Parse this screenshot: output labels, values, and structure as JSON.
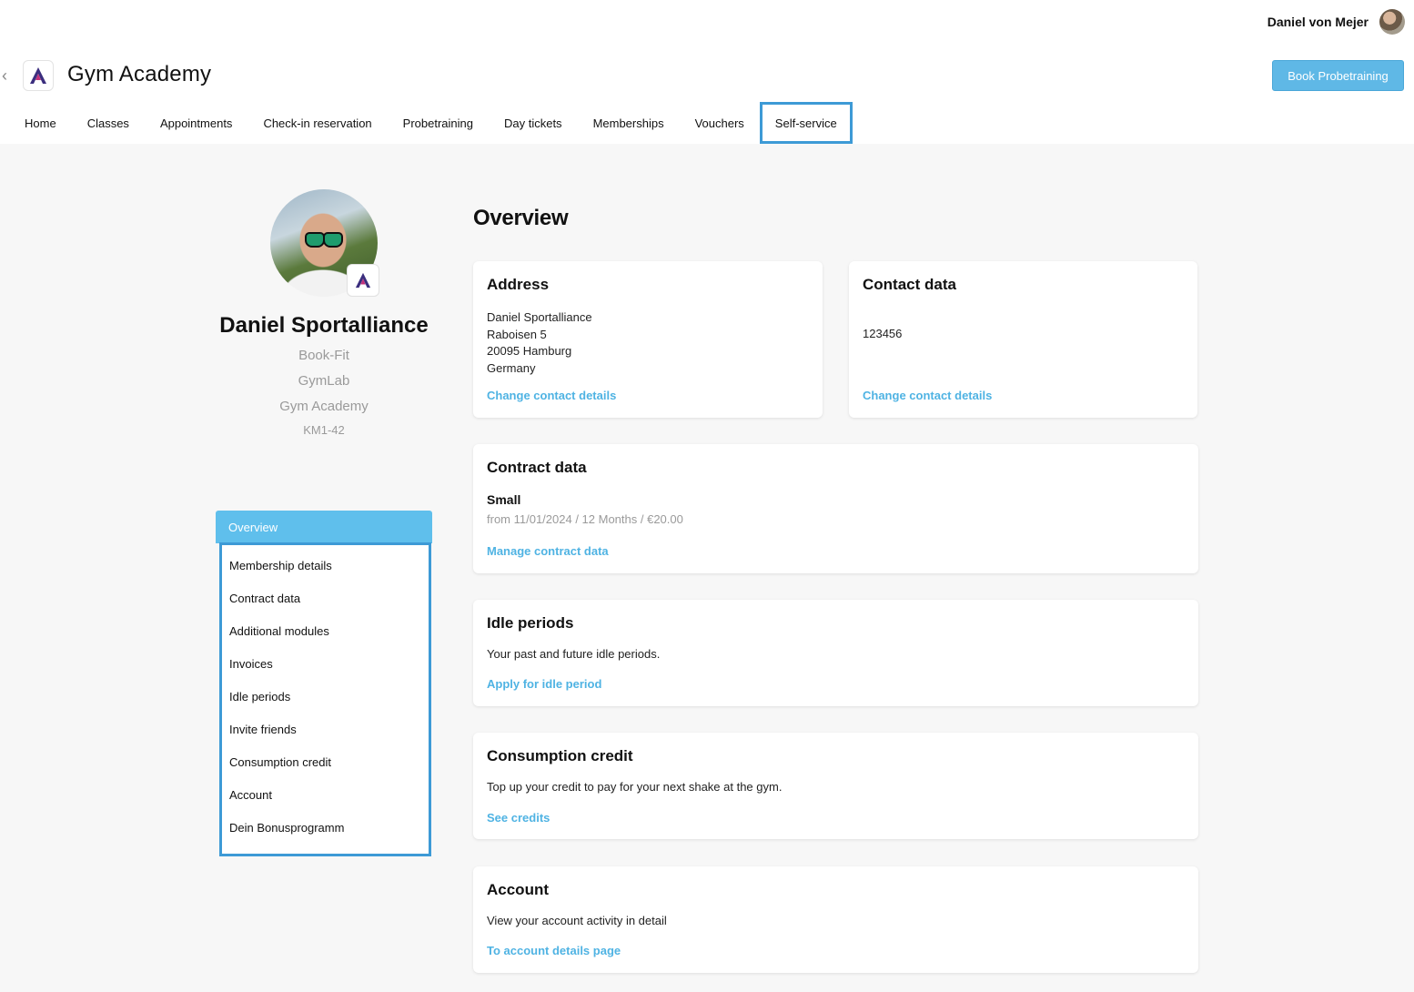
{
  "header": {
    "user_name": "Daniel von Mejer",
    "app_title": "Gym Academy",
    "book_button": "Book Probetraining"
  },
  "nav": {
    "tabs": [
      "Home",
      "Classes",
      "Appointments",
      "Check-in reservation",
      "Probetraining",
      "Day tickets",
      "Memberships",
      "Vouchers",
      "Self-service"
    ],
    "active_tab": "Self-service"
  },
  "profile": {
    "name": "Daniel Sportalliance",
    "studios": [
      "Book-Fit",
      "GymLab",
      "Gym Academy"
    ],
    "member_id": "KM1-42"
  },
  "sidebar": {
    "active": "Overview",
    "items": [
      "Membership details",
      "Contract data",
      "Additional modules",
      "Invoices",
      "Idle periods",
      "Invite friends",
      "Consumption credit",
      "Account",
      "Dein Bonusprogramm"
    ]
  },
  "main": {
    "heading": "Overview",
    "address": {
      "title": "Address",
      "lines": [
        "Daniel Sportalliance",
        "Raboisen 5",
        "20095 Hamburg",
        "Germany"
      ],
      "link": "Change contact details"
    },
    "contact": {
      "title": "Contact data",
      "phone": "123456",
      "link": "Change contact details"
    },
    "contract": {
      "title": "Contract data",
      "plan": "Small",
      "details": "from 11/01/2024 / 12 Months / €20.00",
      "link": "Manage contract data"
    },
    "idle": {
      "title": "Idle periods",
      "text": "Your past and future idle periods.",
      "link": "Apply for idle period"
    },
    "credit": {
      "title": "Consumption credit",
      "text": "Top up your credit to pay for your next shake at the gym.",
      "link": "See credits"
    },
    "account": {
      "title": "Account",
      "text": "View your account activity in detail",
      "link": "To account details page"
    }
  },
  "colors": {
    "accent": "#5fbfec",
    "link": "#4fb3e3",
    "highlight_border": "#3d9ad6"
  },
  "icons": [
    "chevron-left-icon",
    "gym-logo-icon",
    "user-avatar"
  ]
}
